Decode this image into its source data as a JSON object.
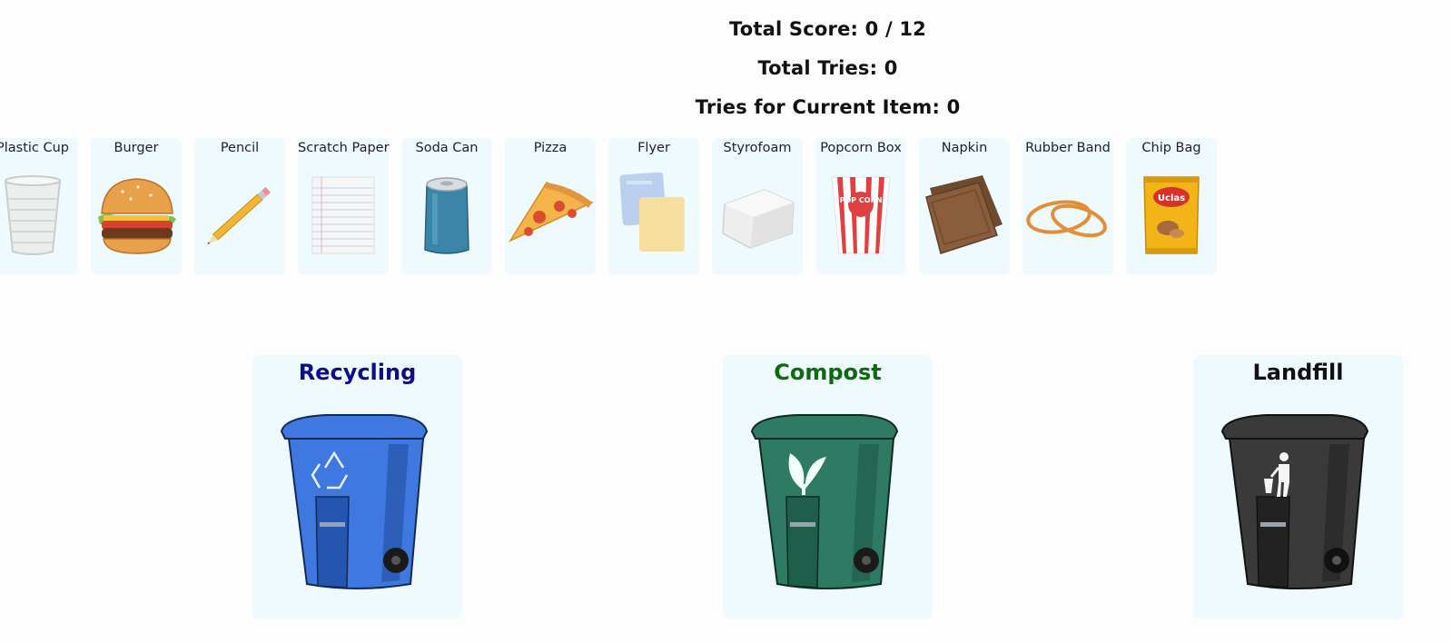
{
  "stats": {
    "total_score": "Total Score: 0 / 12",
    "total_tries": "Total Tries: 0",
    "current_tries": "Tries for Current Item: 0"
  },
  "items": [
    {
      "label": "Plastic Cup",
      "icon": "plastic-cup-icon"
    },
    {
      "label": "Burger",
      "icon": "burger-icon"
    },
    {
      "label": "Pencil",
      "icon": "pencil-icon"
    },
    {
      "label": "Scratch Paper",
      "icon": "scratch-paper-icon"
    },
    {
      "label": "Soda Can",
      "icon": "soda-can-icon"
    },
    {
      "label": "Pizza",
      "icon": "pizza-icon"
    },
    {
      "label": "Flyer",
      "icon": "flyer-icon"
    },
    {
      "label": "Styrofoam",
      "icon": "styrofoam-icon"
    },
    {
      "label": "Popcorn Box",
      "icon": "popcorn-box-icon"
    },
    {
      "label": "Napkin",
      "icon": "napkin-icon"
    },
    {
      "label": "Rubber Band",
      "icon": "rubber-band-icon"
    },
    {
      "label": "Chip Bag",
      "icon": "chip-bag-icon"
    }
  ],
  "bins": {
    "recycling": {
      "label": "Recycling",
      "color": "#0d0d8a",
      "bin_color": "#3f78e0",
      "icon": "recycle-symbol-icon"
    },
    "compost": {
      "label": "Compost",
      "color": "#0d6b0d",
      "bin_color": "#2f7a62",
      "icon": "compost-leaf-icon"
    },
    "landfill": {
      "label": "Landfill",
      "color": "#111111",
      "bin_color": "#3a3a3a",
      "icon": "trash-person-icon"
    }
  },
  "packaging_text": {
    "chip_bag_brand": "Uclas",
    "popcorn": "POP CORN"
  }
}
